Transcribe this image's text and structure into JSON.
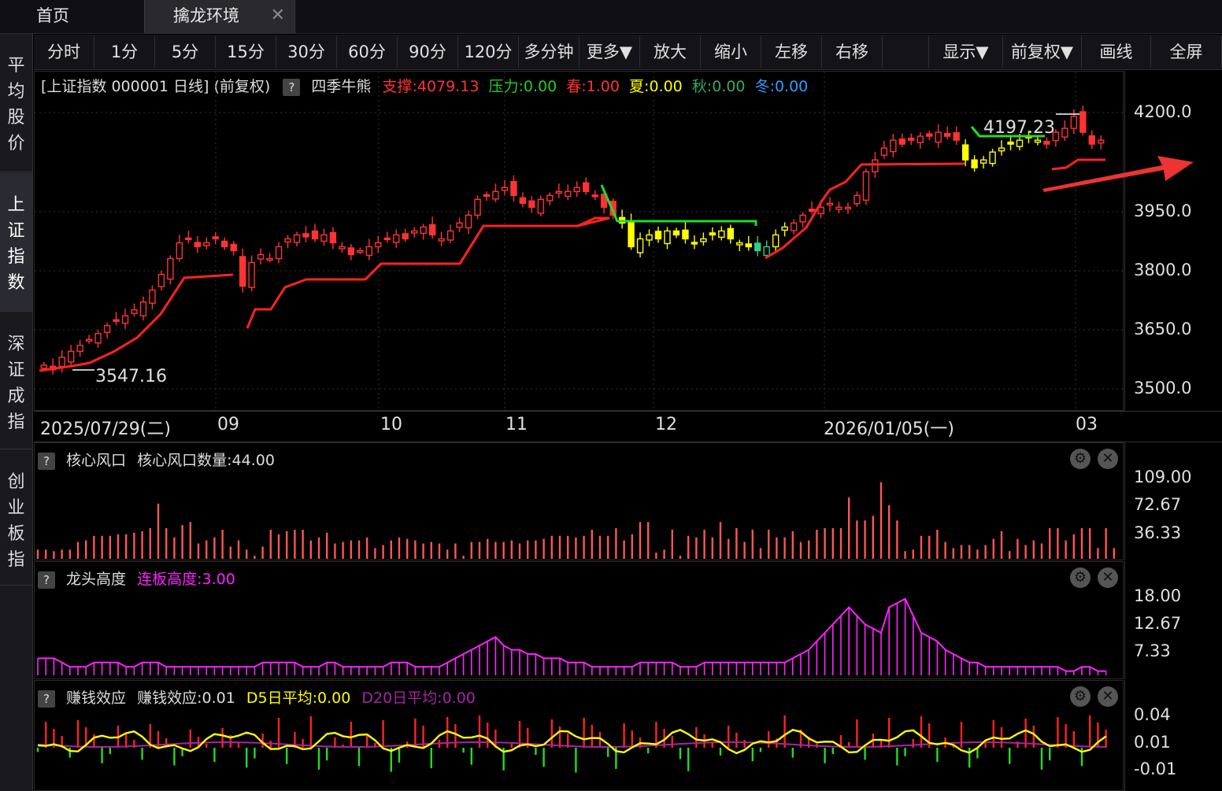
{
  "tabs": {
    "home": "首页",
    "env": "擒龙环境",
    "close": "✕"
  },
  "leftnav": [
    "平均股价",
    "上证指数",
    "深证成指",
    "创业板指"
  ],
  "toolbar": [
    "分时",
    "1分",
    "5分",
    "15分",
    "30分",
    "60分",
    "90分",
    "120分",
    "多分钟",
    "更多▼",
    "放大",
    "缩小",
    "左移",
    "右移",
    "",
    "显示▼",
    "前复权▼",
    "画线",
    "全屏"
  ],
  "main": {
    "title": "[上证指数 000001 日线] (前复权)",
    "question": "?",
    "indicator": "四季牛熊",
    "support_label": "支撑:",
    "support_value": "4079.13",
    "pressure_label": "压力:",
    "pressure_value": "0.00",
    "spring_label": "春:",
    "spring_value": "1.00",
    "summer_label": "夏:",
    "summer_value": "0.00",
    "autumn_label": "秋:",
    "autumn_value": "0.00",
    "winter_label": "冬:",
    "winter_value": "0.00",
    "high_label": "4197.23",
    "low_label": "3547.16",
    "yticks": [
      "4200.0",
      "3950.0",
      "3800.0",
      "3650.0",
      "3500.0"
    ],
    "dates": [
      "2025/07/29(二)",
      "09",
      "10",
      "11",
      "12",
      "2026/01/05(一)",
      "03"
    ]
  },
  "panel1": {
    "name": "核心风口",
    "field": "核心风口数量:44.00",
    "yticks": [
      "109.00",
      "72.67",
      "36.33"
    ]
  },
  "panel2": {
    "name": "龙头高度",
    "field": "连板高度:3.00",
    "yticks": [
      "18.00",
      "12.67",
      "7.33"
    ]
  },
  "panel3": {
    "name": "赚钱效应",
    "field": "赚钱效应:0.01",
    "d5": "D5日平均:0.00",
    "d20": "D20日平均:0.00",
    "yticks": [
      "0.04",
      "0.01",
      "-0.01"
    ]
  },
  "colors": {
    "red": "#ff3333",
    "green": "#22cc22",
    "yellow": "#ffff00",
    "magenta": "#ff22ff",
    "blue": "#3399ff",
    "seasonGreen": "#33aa66"
  },
  "chart_data": {
    "type": "candlestick",
    "ylim": [
      3500,
      4230
    ],
    "series": [
      {
        "values": [
          3560,
          3548,
          3580,
          3595,
          3610,
          3625,
          3640,
          3660,
          3672,
          3685,
          3700,
          3720,
          3750,
          3790,
          3830,
          3870,
          3880,
          3860,
          3870,
          3880,
          3860,
          3850,
          3760,
          3820,
          3840,
          3830,
          3860,
          3880,
          3890,
          3885,
          3880,
          3890,
          3870,
          3860,
          3840,
          3850,
          3860,
          3870,
          3880,
          3890,
          3880,
          3900,
          3910,
          3890,
          3880,
          3900,
          3920,
          3940,
          3980,
          3990,
          4000,
          4010,
          3990,
          3970,
          3960,
          3980,
          3990,
          4000,
          4000,
          4010,
          4000,
          3990,
          3960,
          3940,
          3920,
          3860,
          3880,
          3890,
          3880,
          3900,
          3890,
          3880,
          3870,
          3880,
          3890,
          3900,
          3880,
          3870,
          3860,
          3850,
          3860,
          3890,
          3910,
          3920,
          3940,
          3950,
          3960,
          3970,
          3960,
          3960,
          3990,
          4050,
          4080,
          4110,
          4130,
          4120,
          4130,
          4140,
          4140,
          4150,
          4140,
          4130,
          4080,
          4060,
          4080,
          4100,
          4110,
          4120,
          4130,
          4140,
          4130,
          4120,
          4150,
          4160,
          4190,
          4150,
          4120,
          4130
        ]
      }
    ]
  }
}
